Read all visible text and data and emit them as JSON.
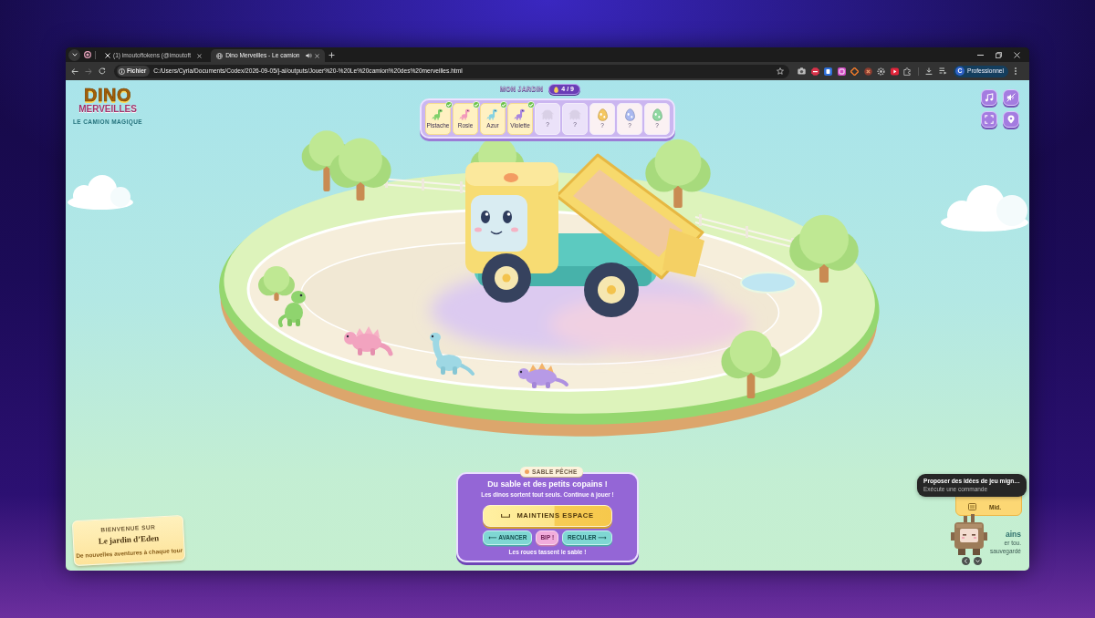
{
  "browser": {
    "tabs": [
      {
        "title": "(1) imoutoftokens (@imoutoft",
        "kind": "social",
        "selected": false,
        "audio": false
      },
      {
        "title": "Dino Merveilles - Le camion",
        "kind": "page",
        "selected": true,
        "audio": true
      }
    ],
    "forward_enabled": false,
    "address": {
      "chip": "Fichier",
      "url": "C:/Users/Cyria/Documents/Codex/2026-09-05/j-ai/outputs/Jouer%20-%20Le%20camion%20des%20merveilles.html",
      "bookmarked": false
    },
    "profile": {
      "initial": "C",
      "label": "Professionnel"
    }
  },
  "game": {
    "logo": {
      "title": "DINO",
      "subtitle": "MERVEILLES",
      "tagline": "LE CAMION MAGIQUE"
    },
    "garden": {
      "title": "MON JARDIN",
      "count": "4 / 9",
      "slots": [
        {
          "kind": "dino",
          "label": "Pistache",
          "color": "#7fd06a",
          "found": true
        },
        {
          "kind": "dino",
          "label": "Rosie",
          "color": "#f39abb",
          "found": true
        },
        {
          "kind": "dino",
          "label": "Azur",
          "color": "#86d2e2",
          "found": true
        },
        {
          "kind": "dino",
          "label": "Violette",
          "color": "#a885e0",
          "found": true
        },
        {
          "kind": "silhouette",
          "label": "?",
          "found": false
        },
        {
          "kind": "silhouette",
          "label": "?",
          "found": false
        },
        {
          "kind": "egg",
          "label": "?",
          "color": "#f5c760",
          "found": false
        },
        {
          "kind": "egg",
          "label": "?",
          "color": "#a9b8f0",
          "found": false
        },
        {
          "kind": "egg",
          "label": "?",
          "color": "#8fd8a2",
          "found": false
        }
      ]
    },
    "mission": {
      "tag": "SABLE PÊCHE",
      "title": "Du sable et des petits copains !",
      "subtitle": "Les dinos sortent tout seuls. Continue à jouer !",
      "main_button": "MAINTIENS ESPACE",
      "buttons": [
        {
          "label": "⟵ AVANCER",
          "kind": "forward"
        },
        {
          "label": "BIP !",
          "kind": "horn"
        },
        {
          "label": "RECULER ⟶",
          "kind": "reverse"
        }
      ],
      "hint": "Les roues tassent le sable !"
    },
    "welcome": {
      "eyebrow": "BIENVENUE SUR",
      "title": "Le jardin d’Eden",
      "subtitle": "De nouvelles aventures à chaque tour"
    },
    "side": {
      "card_label": "Mid.",
      "tooltip": {
        "title": "Proposer des idées de jeu mign…",
        "subtitle": "Exécute une commande"
      },
      "heading": "ains",
      "lines": [
        "er tou.",
        "sauvegardé"
      ]
    }
  }
}
